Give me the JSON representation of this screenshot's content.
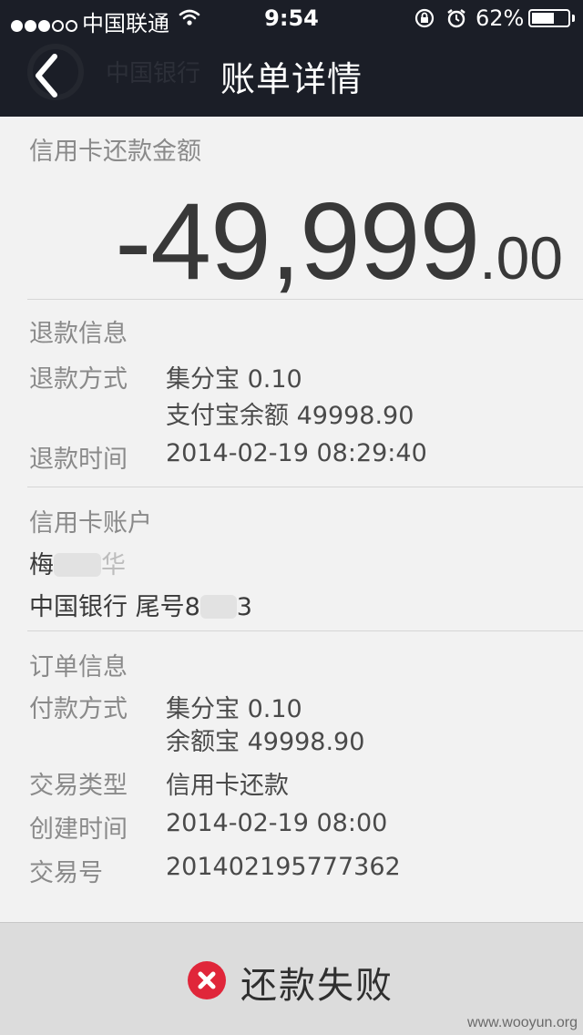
{
  "status_bar": {
    "carrier": "中国联通",
    "time": "9:54",
    "battery_percent": "62%",
    "battery_level": 0.62,
    "signal_strength": 3,
    "signal_total": 5
  },
  "nav": {
    "title": "账单详情",
    "bank_name_faint": "中国银行",
    "back_icon": "chevron-left-icon"
  },
  "amount_section": {
    "title": "信用卡还款金额",
    "amount_integer": "-49,999",
    "amount_decimal": ".00"
  },
  "refund_info": {
    "title": "退款信息",
    "method_label": "退款方式",
    "method_values": [
      "集分宝 0.10",
      "支付宝余额 49998.90"
    ],
    "time_label": "退款时间",
    "time_value": "2014-02-19 08:29:40"
  },
  "card_account": {
    "title": "信用卡账户",
    "holder_visible": "梅",
    "holder_tail_visible": "华",
    "bank_tail_visible": "中国银行 尾号8",
    "bank_last_visible": "3"
  },
  "order_info": {
    "title": "订单信息",
    "payment_label": "付款方式",
    "payment_values": [
      "集分宝 0.10",
      "余额宝 49998.90"
    ],
    "type_label": "交易类型",
    "type_value": "信用卡还款",
    "created_label": "创建时间",
    "created_value": "2014-02-19 08:00",
    "txn_label": "交易号",
    "txn_value": "201402195777362"
  },
  "footer": {
    "status_text": "还款失败",
    "status_icon": "error-x-icon",
    "status_color": "#e0263a"
  },
  "watermark": "www.wooyun.org"
}
